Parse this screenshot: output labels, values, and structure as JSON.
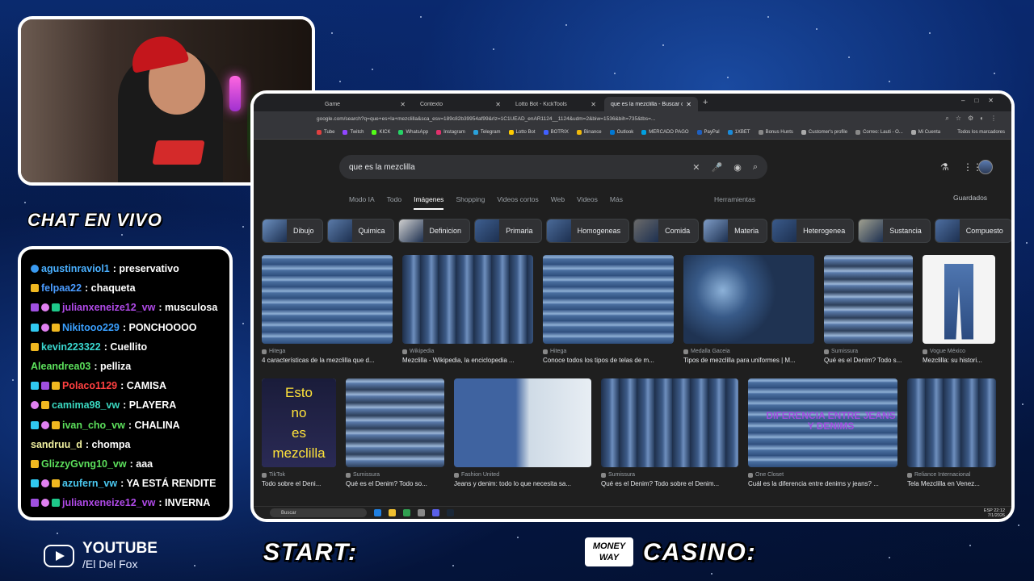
{
  "overlay": {
    "chat_title": "CHAT EN VIVO",
    "start_label": "START:",
    "casino_label": "CASINO:",
    "moneyway_logo": "MONEY WAY",
    "youtube_title": "YOUTUBE",
    "youtube_handle": "/El Del Fox"
  },
  "chat": [
    {
      "user": "agustinraviol1",
      "text": ": preservativo",
      "color": "#4ab0ff",
      "badges": [
        "b-blue"
      ]
    },
    {
      "user": "felpaa22",
      "text": ": chaqueta",
      "color": "#4a9cff",
      "badges": [
        "b-gold"
      ]
    },
    {
      "user": "julianxeneize12_vw",
      "text": ": musculosa",
      "color": "#b04ae8",
      "badges": [
        "b-purple",
        "b-pink",
        "b-green"
      ]
    },
    {
      "user": "Nikitooo229",
      "text": ": PONCHOOOO",
      "color": "#3aa0ff",
      "badges": [
        "b-cyan",
        "b-pink",
        "b-gold"
      ]
    },
    {
      "user": "kevin223322",
      "text": ": Cuellito",
      "color": "#3ad8d0",
      "badges": [
        "b-gold"
      ]
    },
    {
      "user": "Aleandrea03",
      "text": ": pelliza",
      "color": "#5ce05c",
      "badges": []
    },
    {
      "user": "Polaco1129",
      "text": ": CAMISA",
      "color": "#ff4040",
      "badges": [
        "b-cyan",
        "b-purple",
        "b-gold"
      ]
    },
    {
      "user": "camima98_vw",
      "text": ": PLAYERA",
      "color": "#3ad8c0",
      "badges": [
        "b-pink",
        "b-gold"
      ]
    },
    {
      "user": "ivan_cho_vw",
      "text": ": CHALINA",
      "color": "#5ce05c",
      "badges": [
        "b-cyan",
        "b-pink",
        "b-gold"
      ]
    },
    {
      "user": "sandruu_d",
      "text": ": chompa",
      "color": "#f0f0a0",
      "badges": []
    },
    {
      "user": "GlizzyGvng10_vw",
      "text": ": aaa",
      "color": "#5ce05c",
      "badges": [
        "b-gold"
      ]
    },
    {
      "user": "azufern_vw",
      "text": ": YA ESTÁ RENDITE",
      "color": "#4ac8f0",
      "badges": [
        "b-cyan",
        "b-pink",
        "b-gold"
      ]
    },
    {
      "user": "julianxeneize12_vw",
      "text": ": INVERNA",
      "color": "#b04ae8",
      "badges": [
        "b-purple",
        "b-pink",
        "b-green"
      ]
    }
  ],
  "browser": {
    "tabs": [
      {
        "title": "Game",
        "active": false
      },
      {
        "title": "Contexto",
        "active": false
      },
      {
        "title": "Lotto Bot - KickTools",
        "active": false
      },
      {
        "title": "que es la mezclilla - Buscar co",
        "active": true
      }
    ],
    "url": "google.com/search?q=que+es+la+mezclilla&sca_esv=189c82b39954af99&rlz=1C1UEAD_enAR1124__1124&udm=2&biw=1536&bih=735&tbs=...",
    "bookmarks": [
      "Tube",
      "Twitch",
      "KICK",
      "WhatsApp",
      "Instagram",
      "Telegram",
      "Lotto Bot",
      "BOTRIX",
      "Binance",
      "Outlook",
      "MERCADO PAGO",
      "PayPal",
      "1XBET",
      "Bonus Hunts",
      "Customer's profile",
      "Correo: Lauti - O...",
      "Mi Cuenta"
    ],
    "bookmarks_right": "Todos los marcadores",
    "search_query": "que es la mezclilla",
    "nav_tabs": [
      "Modo IA",
      "Todo",
      "Imágenes",
      "Shopping",
      "Videos cortos",
      "Web",
      "Videos",
      "Más"
    ],
    "tools": "Herramientas",
    "saved": "Guardados",
    "chips": [
      "Dibujo",
      "Quimica",
      "Definicion",
      "Primaria",
      "Homogeneas",
      "Comida",
      "Materia",
      "Heterogenea",
      "Sustancia",
      "Compuesto"
    ],
    "row1": [
      {
        "source": "Hitega",
        "caption": "4 características de la mezclilla que d..."
      },
      {
        "source": "Wikipedia",
        "caption": "Mezclilla - Wikipedia, la enciclopedia ..."
      },
      {
        "source": "Hitega",
        "caption": "Conoce todos los tipos de telas de m..."
      },
      {
        "source": "Medalla Gaceia",
        "caption": "Tipos de mezclilla para uniformes | M..."
      },
      {
        "source": "Sumissura",
        "caption": "Qué es el Denim? Todo s..."
      },
      {
        "source": "Vogue México",
        "caption": "Mezclilla: su histori..."
      }
    ],
    "row2": [
      {
        "source": "TikTok",
        "caption": "Todo sobre el Deni..."
      },
      {
        "source": "Sumissura",
        "caption": "Qué es el Denim? Todo so..."
      },
      {
        "source": "Fashion United",
        "caption": "Jeans y denim: todo lo que necesita sa..."
      },
      {
        "source": "Sumissura",
        "caption": "Qué es el Denim? Todo sobre el Denim..."
      },
      {
        "source": "One Closet",
        "caption": "Cuál es la diferencia entre denims y jeans? ..."
      },
      {
        "source": "Reliance Internacional",
        "caption": "Tela Mezclilla en Venez..."
      }
    ],
    "esto_text": [
      "Esto",
      "no",
      "es",
      "mezclilla"
    ],
    "diferencia_text": "DIFERENCIA ENTRE JEANS Y DENIMS",
    "taskbar_search": "Buscar",
    "taskbar_lang": "ESP",
    "taskbar_time": "22:12",
    "taskbar_date": "7/1/2026"
  }
}
